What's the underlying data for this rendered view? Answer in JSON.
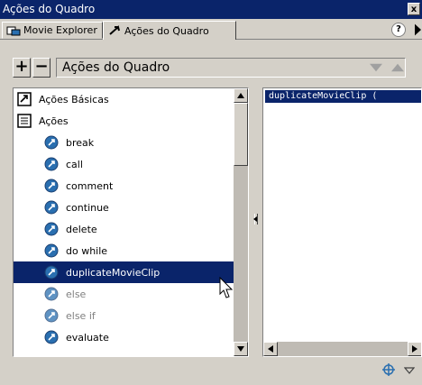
{
  "window": {
    "title": "Ações do Quadro",
    "close_label": "x"
  },
  "tabs": [
    {
      "label": "Movie Explorer"
    },
    {
      "label": "Ações do Quadro"
    }
  ],
  "help_label": "?",
  "toolbar": {
    "add_label": "+",
    "remove_label": "−",
    "title": "Ações do Quadro"
  },
  "tree": {
    "items": [
      {
        "label": "Ações Básicas",
        "level": "top",
        "icon": "book-icon"
      },
      {
        "label": "Ações",
        "level": "top",
        "icon": "book-open-icon"
      },
      {
        "label": "break",
        "level": "child",
        "icon": "action-icon"
      },
      {
        "label": "call",
        "level": "child",
        "icon": "action-icon"
      },
      {
        "label": "comment",
        "level": "child",
        "icon": "action-icon"
      },
      {
        "label": "continue",
        "level": "child",
        "icon": "action-icon"
      },
      {
        "label": "delete",
        "level": "child",
        "icon": "action-icon"
      },
      {
        "label": "do while",
        "level": "child",
        "icon": "action-icon"
      },
      {
        "label": "duplicateMovieClip",
        "level": "child",
        "icon": "action-icon",
        "selected": true
      },
      {
        "label": "else",
        "level": "child",
        "icon": "action-icon",
        "disabled": true
      },
      {
        "label": "else if",
        "level": "child",
        "icon": "action-icon",
        "disabled": true
      },
      {
        "label": "evaluate",
        "level": "child",
        "icon": "action-icon"
      }
    ]
  },
  "script": {
    "line": "duplicateMovieClip ("
  },
  "colors": {
    "selection": "#0a246a",
    "face": "#d4d0c8",
    "action_icon": "#2a6fb0"
  }
}
